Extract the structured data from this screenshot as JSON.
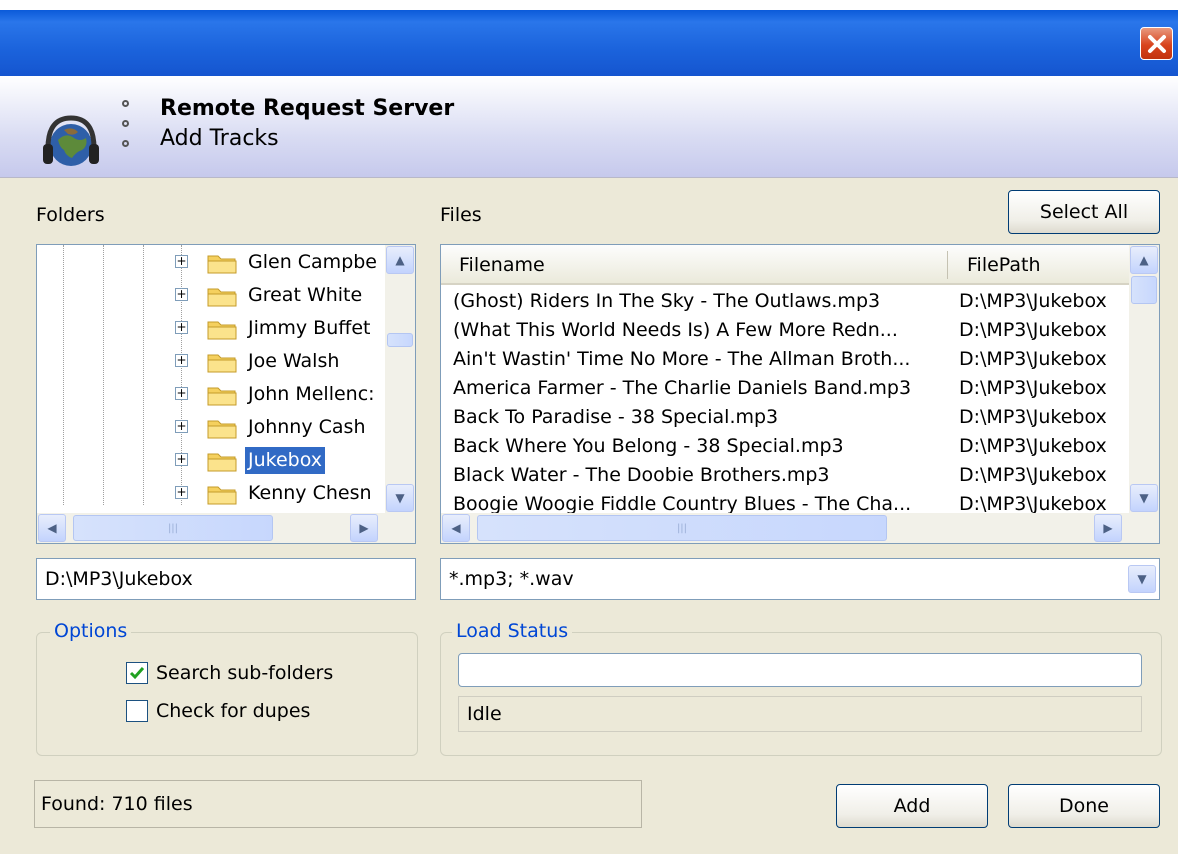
{
  "header": {
    "title": "Remote Request Server",
    "subtitle": "Add Tracks"
  },
  "folders": {
    "label": "Folders",
    "items": [
      {
        "name": "Glen Campbe",
        "selected": false
      },
      {
        "name": "Great White",
        "selected": false
      },
      {
        "name": "Jimmy Buffet",
        "selected": false
      },
      {
        "name": "Joe Walsh",
        "selected": false
      },
      {
        "name": "John Mellenc:",
        "selected": false
      },
      {
        "name": "Johnny Cash",
        "selected": false
      },
      {
        "name": "Jukebox",
        "selected": true
      },
      {
        "name": "Kenny Chesn",
        "selected": false
      }
    ],
    "path_value": "D:\\MP3\\Jukebox"
  },
  "files": {
    "label": "Files",
    "select_all_label": "Select All",
    "columns": [
      "Filename",
      "FilePath"
    ],
    "rows": [
      {
        "filename": "(Ghost) Riders In The Sky - The Outlaws.mp3",
        "filepath": "D:\\MP3\\Jukebox"
      },
      {
        "filename": "(What This World Needs Is) A Few More Redn...",
        "filepath": "D:\\MP3\\Jukebox"
      },
      {
        "filename": "Ain't Wastin' Time No More - The Allman Broth...",
        "filepath": "D:\\MP3\\Jukebox"
      },
      {
        "filename": "America Farmer - The Charlie Daniels Band.mp3",
        "filepath": "D:\\MP3\\Jukebox"
      },
      {
        "filename": "Back To Paradise - 38 Special.mp3",
        "filepath": "D:\\MP3\\Jukebox"
      },
      {
        "filename": "Back Where You Belong - 38 Special.mp3",
        "filepath": "D:\\MP3\\Jukebox"
      },
      {
        "filename": "Black Water - The Doobie Brothers.mp3",
        "filepath": "D:\\MP3\\Jukebox"
      },
      {
        "filename": "Boogie Woogie Fiddle Country Blues - The Cha...",
        "filepath": "D:\\MP3\\Jukebox"
      }
    ],
    "filter_value": "*.mp3; *.wav"
  },
  "options": {
    "label": "Options",
    "search_subfolders_label": "Search sub-folders",
    "search_subfolders_checked": true,
    "check_dupes_label": "Check for dupes",
    "check_dupes_checked": false
  },
  "load_status": {
    "label": "Load Status",
    "progress": 0,
    "status_text": "Idle"
  },
  "footer": {
    "found_text": "Found: 710 files",
    "add_label": "Add",
    "done_label": "Done"
  },
  "colors": {
    "titlebar": "#1b63dc",
    "selection": "#316ac5",
    "group_label": "#0046d5",
    "window_bg": "#ece9d8"
  }
}
